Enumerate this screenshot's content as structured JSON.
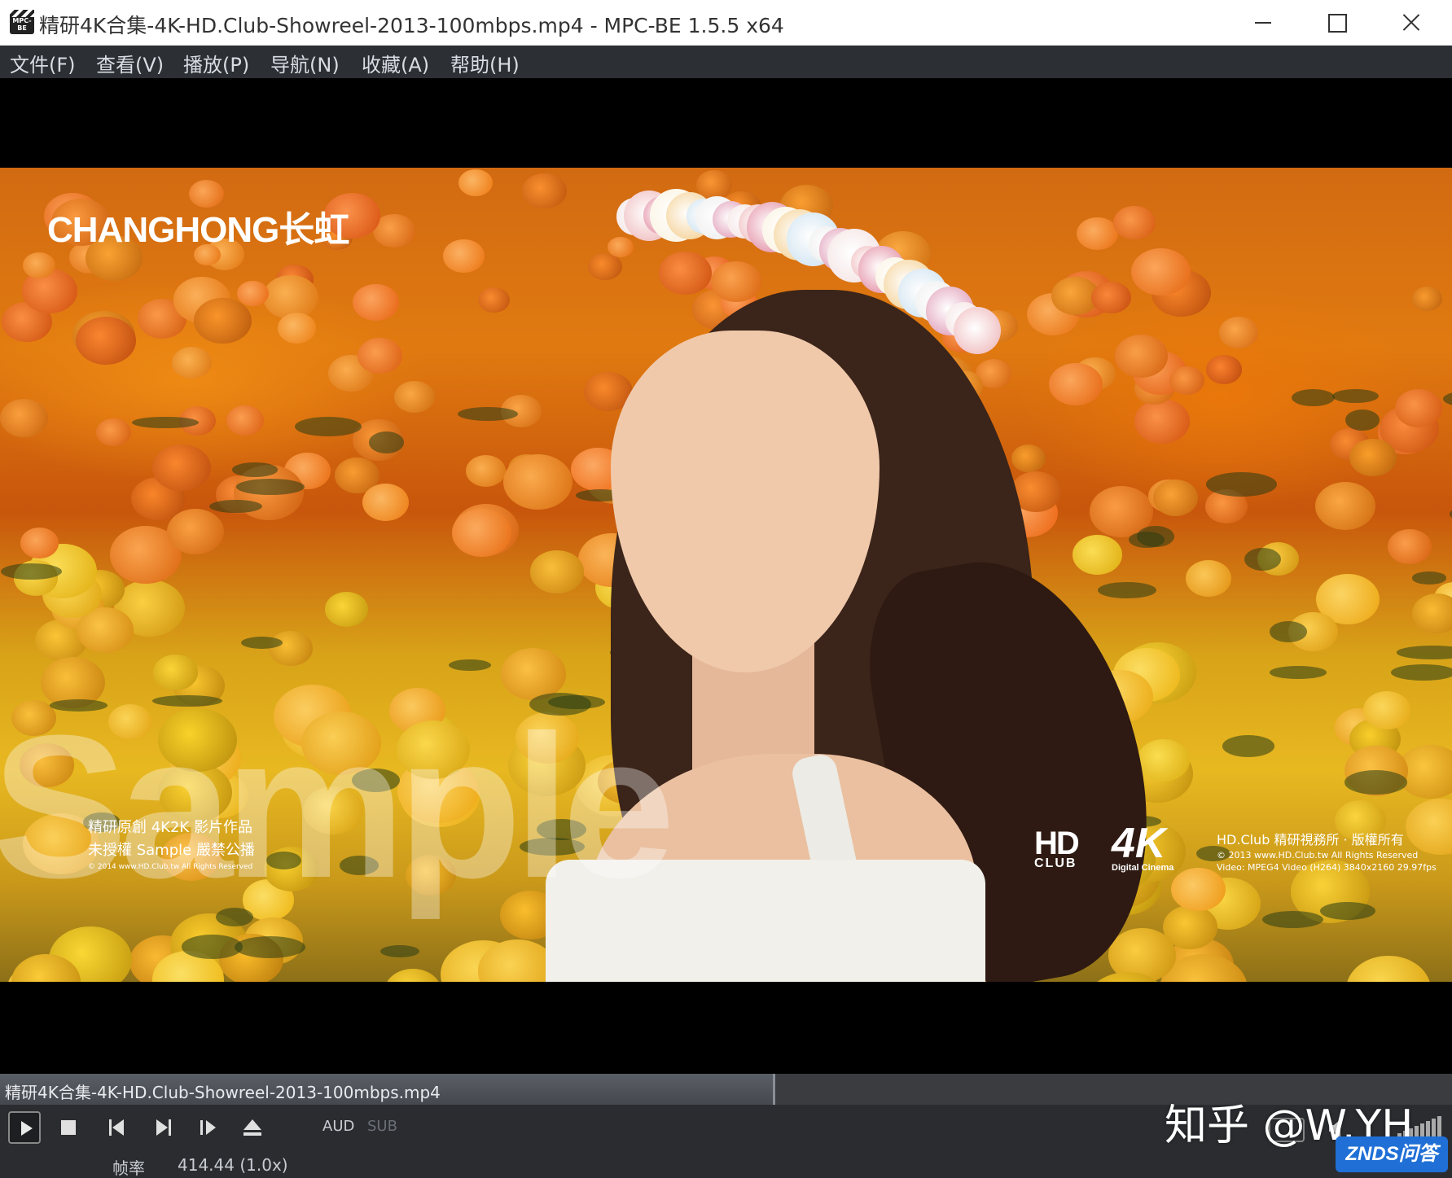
{
  "window": {
    "title": "精研4K合集-4K-HD.Club-Showreel-2013-100mbps.mp4 - MPC-BE 1.5.5 x64",
    "icon_label": "MPC-BE",
    "controls": [
      "minimize-icon",
      "maximize-icon",
      "close-icon"
    ]
  },
  "menu": {
    "items": [
      {
        "label": "文件(F)"
      },
      {
        "label": "查看(V)"
      },
      {
        "label": "播放(P)"
      },
      {
        "label": "导航(N)"
      },
      {
        "label": "收藏(A)"
      },
      {
        "label": "帮助(H)"
      }
    ]
  },
  "video": {
    "brand_logo": "CHANGHONG长虹",
    "watermark": "Sample",
    "notice_line1": "精研原創 4K2K 影片作品",
    "notice_line2": "未授權 Sample 嚴禁公播",
    "notice_line3": "© 2014 www.HD.Club.tw All Rights Reserved",
    "hd_logo_top": "HD",
    "hd_logo_bottom": "CLUB",
    "logo_4k": "4K",
    "logo_4k_sub": "Digital Cinema",
    "copy_line1": "HD.Club  精研視務所 · 版權所有",
    "copy_line2": "© 2013 www.HD.Club.tw All Rights Reserved",
    "copy_line3": "Video: MPEG4 Video (H264) 3840x2160 29.97fps"
  },
  "seek": {
    "filename": "精研4K合集-4K-HD.Club-Showreel-2013-100mbps.mp4",
    "progress": 0.534
  },
  "toolbar": {
    "buttons": [
      "play-icon",
      "stop-icon",
      "previous-icon",
      "next-icon",
      "frame-step-icon",
      "eject-icon"
    ],
    "audio_label": "AUD",
    "subtitle_label": "SUB"
  },
  "status": {
    "label": "帧率",
    "value": "414.44  (1.0x)"
  },
  "overlay": {
    "zhihu_watermark": "知乎 @W.YH",
    "znds_badge": "ZNDS问答"
  },
  "colors": {
    "menubar_bg": "#2c2f34",
    "toolbar_bg": "#2a2c30",
    "seek_bg": "#3a3c40",
    "aud_color": "#c8ccd2",
    "sub_color": "#6a6e76",
    "znds_blue": "#1f6fd6"
  }
}
